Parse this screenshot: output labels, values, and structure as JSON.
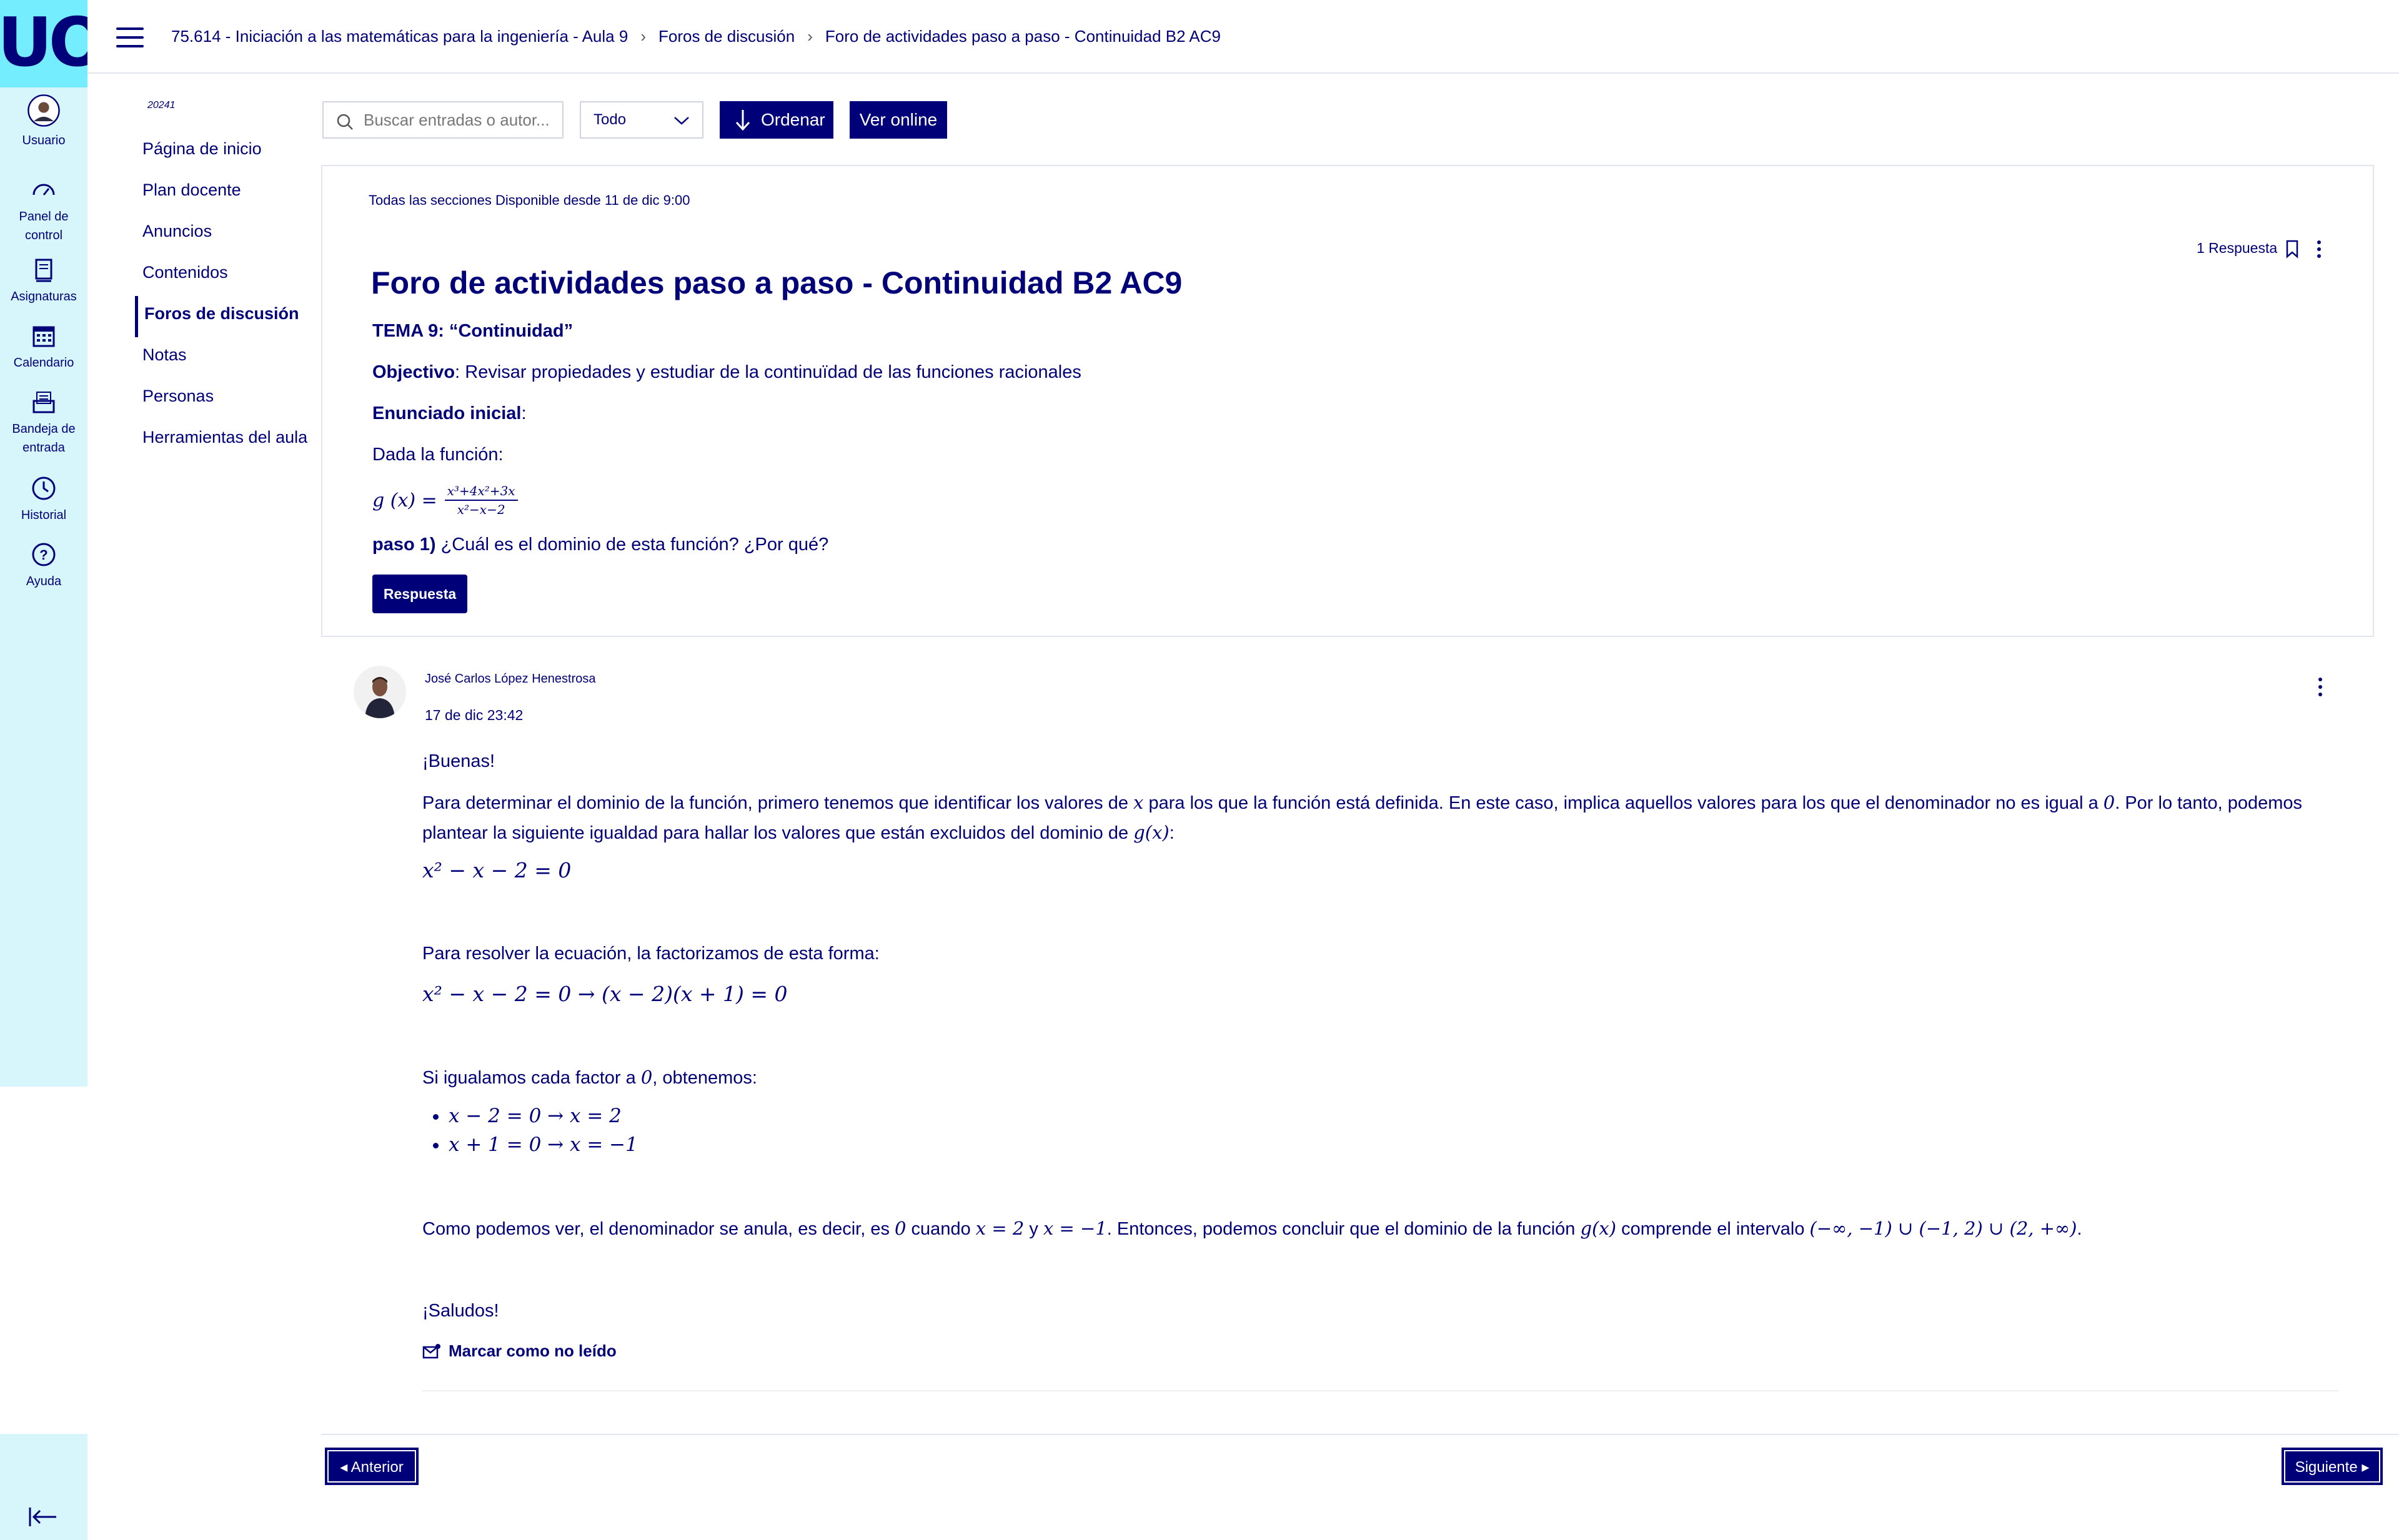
{
  "rail": {
    "logo": "UOC",
    "items": [
      {
        "label": "Usuario",
        "icon": "user-avatar"
      },
      {
        "label": "Panel de control",
        "icon": "dashboard-icon"
      },
      {
        "label": "Asignaturas",
        "icon": "book-icon"
      },
      {
        "label": "Calendario",
        "icon": "calendar-icon"
      },
      {
        "label": "Bandeja de entrada",
        "icon": "inbox-icon"
      },
      {
        "label": "Historial",
        "icon": "clock-icon"
      },
      {
        "label": "Ayuda",
        "icon": "help-icon"
      }
    ]
  },
  "breadcrumb": {
    "course": "75.614 - Iniciación a las matemáticas para la ingeniería - Aula 9",
    "section": "Foros de discusión",
    "current": "Foro de actividades paso a paso - Continuidad B2 AC9"
  },
  "subnav": {
    "semester": "20241",
    "items": [
      "Página de inicio",
      "Plan docente",
      "Anuncios",
      "Contenidos",
      "Foros de discusión",
      "Notas",
      "Personas",
      "Herramientas del aula"
    ],
    "active": "Foros de discusión"
  },
  "toolbar": {
    "search_placeholder": "Buscar entradas o autor...",
    "filter_value": "Todo",
    "order_label": "Ordenar",
    "online_label": "Ver online"
  },
  "post": {
    "meta": "Todas las secciones Disponible desde 11 de dic 9:00",
    "replies": "1 Respuesta",
    "title": "Foro de actividades paso a paso - Continuidad B2 AC9",
    "tema": "TEMA 9: “Continuidad”",
    "objective_label": "Objectivo",
    "objective_text": ": Revisar propiedades y estudiar de la continuïdad de las funciones racionales",
    "enunciado": "Enunciado inicial",
    "enunciado_colon": ":",
    "dada": "Dada la función:",
    "formula_lhs": "g (x) =",
    "formula_num": "x³+4x²+3x",
    "formula_den": "x²−x−2",
    "paso_label": "paso 1)",
    "paso_text": " ¿Cuál es el dominio de esta función? ¿Por qué?",
    "reply_button": "Respuesta"
  },
  "reply": {
    "author": "José Carlos López Henestrosa",
    "date": "17 de dic 23:42",
    "greeting": "¡Buenas!",
    "p1a": "Para determinar el dominio de la función, primero tenemos que identificar los valores de ",
    "p1_x": "x",
    "p1b": " para los que la función está definida. En este caso, implica aquellos valores para los que el denominador no es igual a ",
    "p1_zero": "0",
    "p1c": ". Por lo tanto, podemos plantear la siguiente igualdad para hallar los valores que están excluidos del dominio de ",
    "p1_g": "g(x)",
    "p1d": ":",
    "eq1": "x² − x − 2 = 0",
    "p2": "Para resolver la ecuación, la factorizamos de esta forma:",
    "eq2": "x² − x − 2 = 0 → (x − 2)(x + 1) = 0",
    "p3a": "Si igualamos cada factor a ",
    "p3_zero": "0",
    "p3b": ", obtenemos:",
    "bullet1": "x − 2 = 0 → x = 2",
    "bullet2": "x + 1 = 0 → x = −1",
    "p4a": "Como podemos ver, el denominador se anula, es decir, es ",
    "p4_zero": "0",
    "p4b": " cuando ",
    "p4_x2": "x = 2",
    "p4c": " y ",
    "p4_xm1": "x = −1",
    "p4d": ". Entonces, podemos concluir que el dominio de la función ",
    "p4_g": "g(x)",
    "p4e": " comprende el intervalo ",
    "p4_int": "(−∞, −1) ∪ (−1, 2) ∪ (2, +∞)",
    "p4f": ".",
    "closing": "¡Saludos!",
    "mark_unread": "Marcar como no leído"
  },
  "pager": {
    "prev": "◂ Anterior",
    "next": "Siguiente ▸"
  },
  "colors": {
    "brand": "#000078",
    "rail": "#d7f6fb",
    "logo_bg": "#73edff"
  }
}
